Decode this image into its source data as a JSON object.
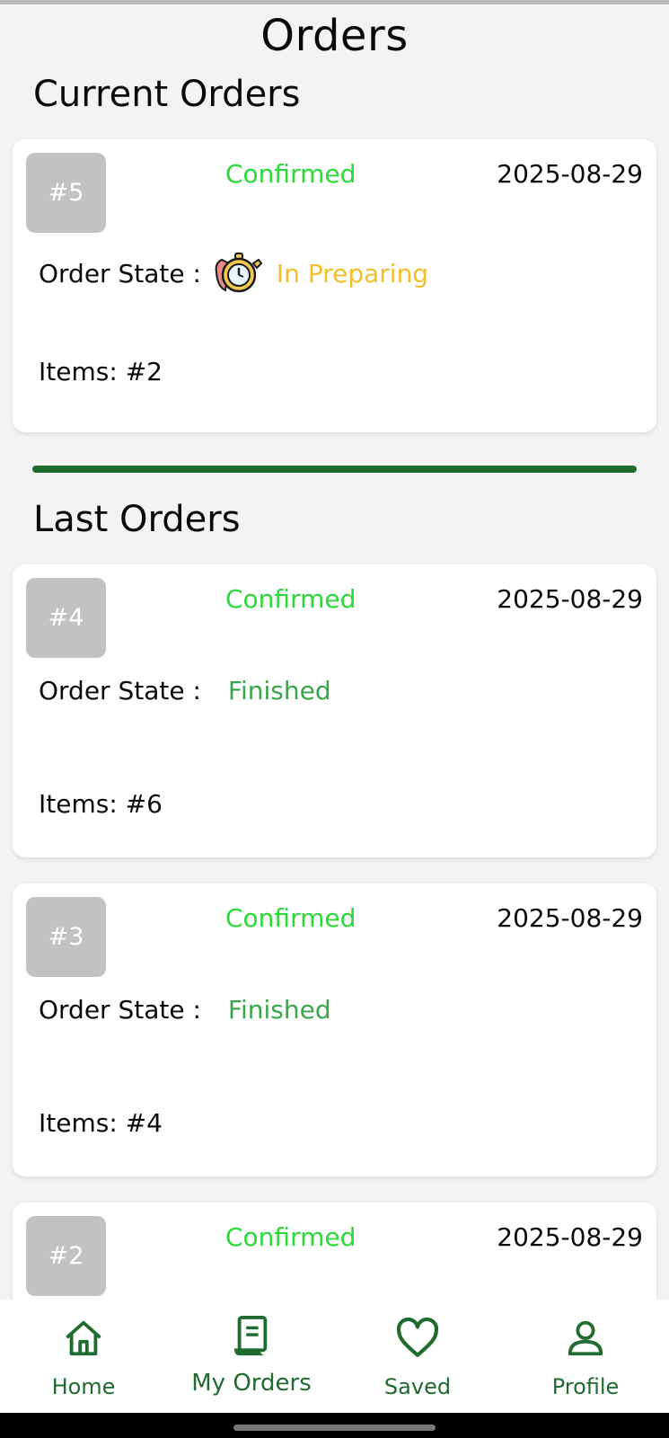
{
  "header": {
    "title": "Orders"
  },
  "sections": {
    "current_title": "Current Orders",
    "last_title": "Last Orders"
  },
  "labels": {
    "order_state": "Order State :"
  },
  "current_orders": [
    {
      "number": "#5",
      "status": "Confirmed",
      "date": "2025-08-29",
      "state": "In Preparing",
      "items": "Items: #2"
    }
  ],
  "last_orders": [
    {
      "number": "#4",
      "status": "Confirmed",
      "date": "2025-08-29",
      "state": "Finished",
      "items": "Items: #6"
    },
    {
      "number": "#3",
      "status": "Confirmed",
      "date": "2025-08-29",
      "state": "Finished",
      "items": "Items: #4"
    },
    {
      "number": "#2",
      "status": "Confirmed",
      "date": "2025-08-29"
    }
  ],
  "nav": [
    {
      "label": "Home",
      "icon": "home-icon"
    },
    {
      "label": "My Orders",
      "icon": "orders-icon"
    },
    {
      "label": "Saved",
      "icon": "heart-icon"
    },
    {
      "label": "Profile",
      "icon": "profile-icon"
    }
  ],
  "colors": {
    "confirmed": "#2bd93a",
    "preparing": "#f2bf2a",
    "finished": "#3aa64c",
    "brand_green": "#1f6b30"
  }
}
